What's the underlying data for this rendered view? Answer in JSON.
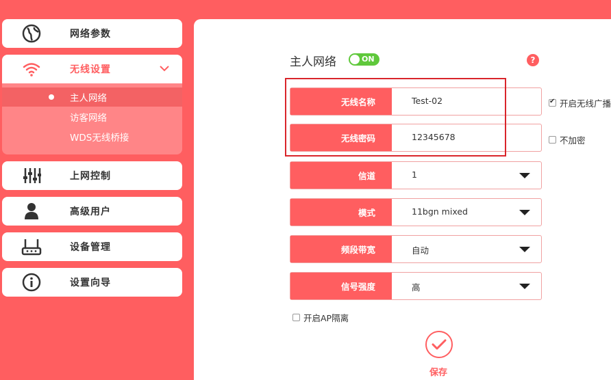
{
  "sidebar": {
    "items": [
      {
        "label": "网络参数",
        "icon": "globe-icon"
      },
      {
        "label": "无线设置",
        "icon": "wifi-icon"
      },
      {
        "label": "上网控制",
        "icon": "sliders-icon"
      },
      {
        "label": "高级用户",
        "icon": "user-icon"
      },
      {
        "label": "设备管理",
        "icon": "router-icon"
      },
      {
        "label": "设置向导",
        "icon": "info-icon"
      }
    ],
    "wireless_submenu": [
      {
        "label": "主人网络",
        "active": true
      },
      {
        "label": "访客网络"
      },
      {
        "label": "WDS无线桥接"
      }
    ]
  },
  "main": {
    "title": "主人网络",
    "toggle_label": "ON",
    "help_label": "?",
    "fields": {
      "ssid": {
        "label": "无线名称",
        "value": "Test-02"
      },
      "password": {
        "label": "无线密码",
        "value": "12345678"
      },
      "channel": {
        "label": "信道",
        "value": "1"
      },
      "mode": {
        "label": "模式",
        "value": "11bgn mixed"
      },
      "bandwidth": {
        "label": "频段带宽",
        "value": "自动"
      },
      "signal": {
        "label": "信号强度",
        "value": "高"
      }
    },
    "broadcast_label": "开启无线广播",
    "no_encrypt_label": "不加密",
    "ap_isolation_label": "开启AP隔离",
    "save_label": "保存"
  },
  "colors": {
    "accent": "#ff5e60",
    "toggle_on": "#5fc83b",
    "highlight_box": "#d9242a"
  }
}
